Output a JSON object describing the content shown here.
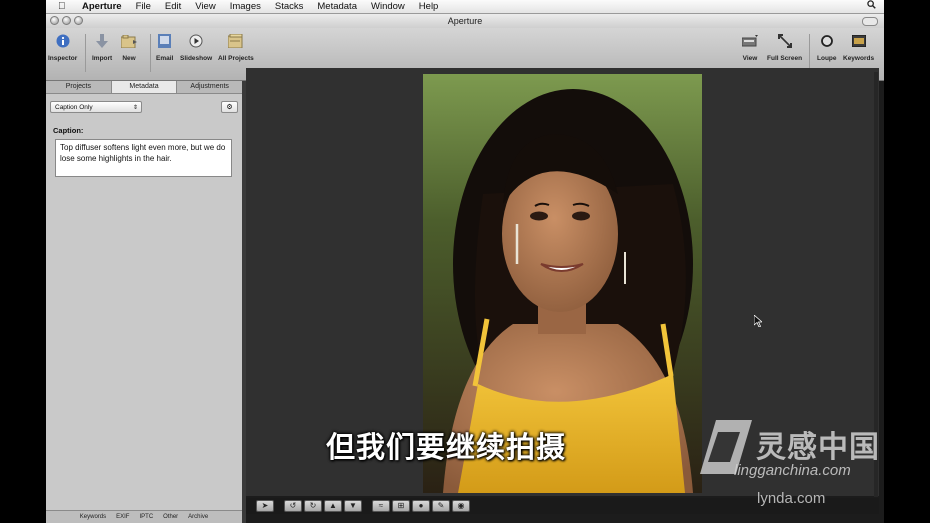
{
  "menubar": {
    "app": "Aperture",
    "items": [
      "File",
      "Edit",
      "View",
      "Images",
      "Stacks",
      "Metadata",
      "Window",
      "Help"
    ]
  },
  "window": {
    "title": "Aperture"
  },
  "toolbar": {
    "inspector": "Inspector",
    "import": "Import",
    "new": "New",
    "email": "Email",
    "slideshow": "Slideshow",
    "all_projects": "All Projects",
    "view": "View",
    "full_screen": "Full Screen",
    "loupe": "Loupe",
    "keywords": "Keywords"
  },
  "inspector": {
    "tabs": [
      "Projects",
      "Metadata",
      "Adjustments"
    ],
    "active_tab": "Metadata",
    "view_popup": "Caption Only",
    "caption_label": "Caption:",
    "caption_text": "Top diffuser softens light even more, but we do lose some highlights in the hair.",
    "bottom_tabs": [
      "Keywords",
      "EXIF",
      "IPTC",
      "Other",
      "Archive"
    ]
  },
  "overlay": {
    "subtitle": "但我们要继续拍摄",
    "watermark_cn": "灵感中国",
    "watermark_en": "lingganchina.com",
    "lynda": "lynda.com"
  },
  "colors": {
    "viewer_bg": "#303030",
    "accent": "#5b8fd8"
  }
}
